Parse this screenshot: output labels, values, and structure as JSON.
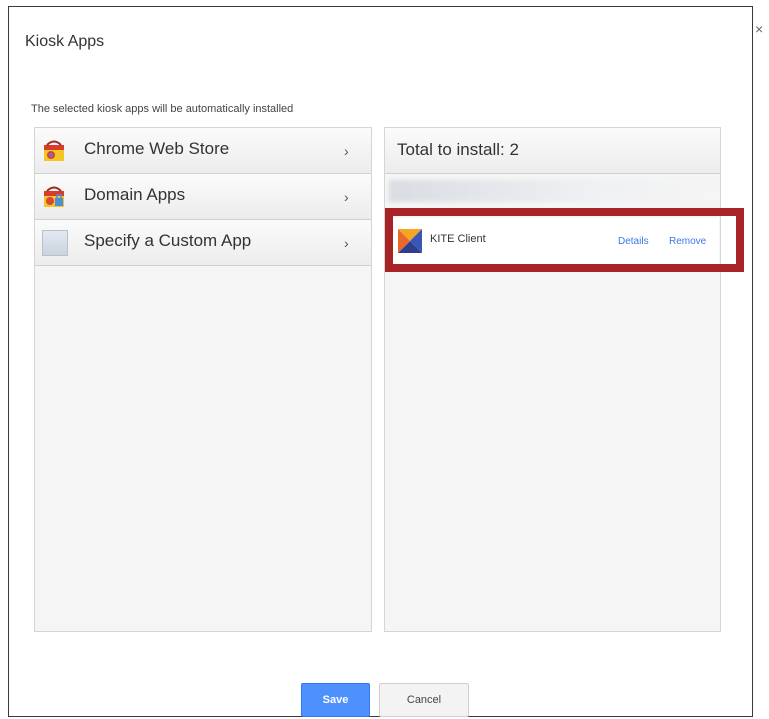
{
  "dialog": {
    "title": "Kiosk Apps",
    "close_glyph": "×",
    "subtitle": "The selected kiosk apps will be automatically installed"
  },
  "sources": {
    "items": [
      {
        "label": "Chrome Web Store",
        "icon": "chrome-web-store-icon",
        "chevron": "›"
      },
      {
        "label": "Domain Apps",
        "icon": "domain-apps-icon",
        "chevron": "›"
      },
      {
        "label": "Specify a Custom App",
        "icon": "custom-app-icon",
        "chevron": "›"
      }
    ]
  },
  "selected": {
    "header": "Total to install: 2",
    "apps": [
      {
        "name": "KITE Client",
        "icon": "kite-client-icon",
        "details_label": "Details",
        "remove_label": "Remove"
      }
    ]
  },
  "footer": {
    "save_label": "Save",
    "cancel_label": "Cancel"
  },
  "colors": {
    "highlight": "#a82328",
    "link": "#3b78e7",
    "primary_button": "#4d90fe"
  }
}
